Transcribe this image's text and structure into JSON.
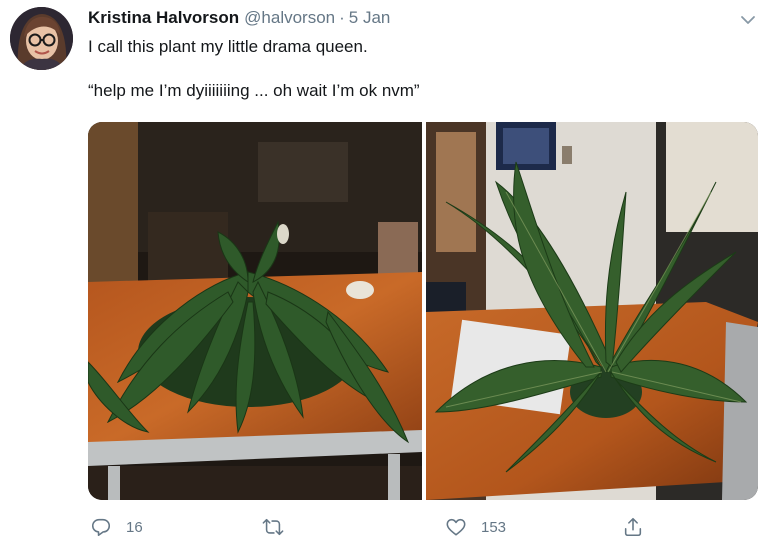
{
  "tweet": {
    "author": {
      "display_name": "Kristina Halvorson",
      "handle": "@halvorson"
    },
    "separator": "·",
    "date": "5 Jan",
    "text_lines": [
      "I call this plant my little drama queen.",
      "“help me I’m dyiiiiiiing ... oh wait I’m ok nvm”"
    ],
    "media": [
      {
        "subject": "drooping peace lily on a wooden table"
      },
      {
        "subject": "perked-up peace lily on a wooden table"
      }
    ],
    "actions": {
      "reply_count": "16",
      "retweet_count": "",
      "like_count": "153",
      "share_count": ""
    }
  },
  "icons": {
    "caret": "chevron-down-icon",
    "reply": "reply-icon",
    "retweet": "retweet-icon",
    "like": "heart-icon",
    "share": "share-icon"
  },
  "colors": {
    "text_primary": "#14171a",
    "text_secondary": "#657786"
  }
}
